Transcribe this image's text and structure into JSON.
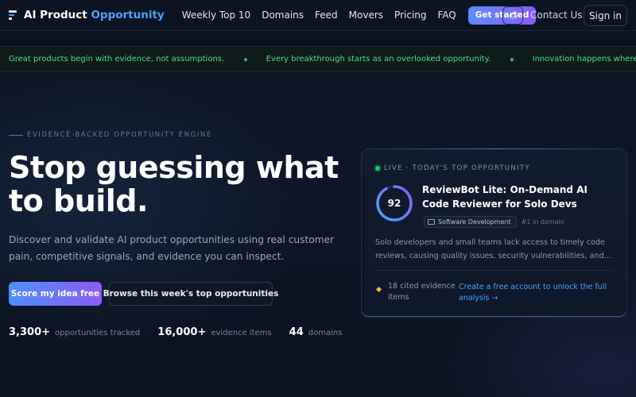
{
  "nav": {
    "logo_text_main": "AI Product ",
    "logo_text_accent": "Opportunity",
    "links": [
      "Weekly Top 10",
      "Domains",
      "Feed",
      "Movers",
      "Pricing",
      "FAQ"
    ],
    "get_started": "Get started",
    "contact": "Contact Us",
    "sign_in": "Sign in",
    "theme_icon": "sun-icon"
  },
  "ticker": {
    "items": [
      "Great products begin with evidence, not assumptions.",
      "Every breakthrough starts as an overlooked opportunity.",
      "Innovation happens where techno"
    ],
    "separator": "◆"
  },
  "hero": {
    "eyebrow": "EVIDENCE-BACKED OPPORTUNITY ENGINE",
    "headline": "Stop guessing what to build.",
    "subhead": "Discover and validate AI product opportunities using real customer pain, competitive signals, and evidence you can inspect.",
    "primary_button": "Score my idea free",
    "secondary_button": "Browse this week's top opportunities",
    "stats": [
      {
        "value": "3,300+",
        "label": "opportunities tracked"
      },
      {
        "value": "16,000+",
        "label": "evidence items"
      },
      {
        "value": "44",
        "label": "domains"
      }
    ]
  },
  "card": {
    "live_label": "LIVE · TODAY'S TOP OPPORTUNITY",
    "score": "92",
    "score_fraction": 0.92,
    "title": "ReviewBot Lite: On-Demand AI Code Reviewer for Solo Devs",
    "tag": "Software Development",
    "rank": "#1 in domain",
    "description": "Solo developers and small teams lack access to timely code reviews, causing quality issues, security vulnerabilities, and...",
    "evidence": "18 cited evidence items",
    "unlock": "Create a free account to unlock the full analysis →"
  },
  "colors": {
    "accent": "#4aa3ff",
    "live": "#22c55e",
    "ticker": "#4ade80",
    "gradient_start": "#4f8dfd",
    "gradient_end": "#8b5cf6"
  }
}
